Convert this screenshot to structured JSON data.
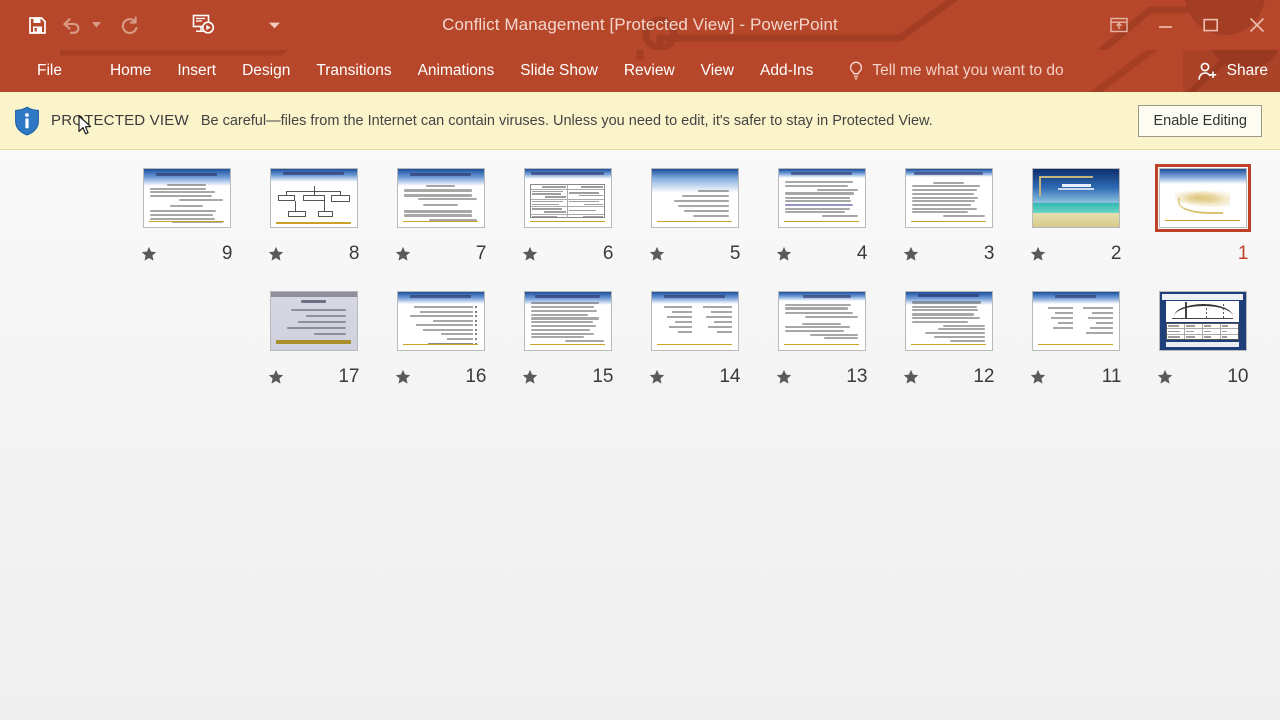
{
  "window": {
    "title": "Conflict Management [Protected View] - PowerPoint",
    "accent_color": "#b7472a"
  },
  "quick_access": {
    "items": [
      {
        "name": "save-icon",
        "label": "Save",
        "enabled": true
      },
      {
        "name": "undo-icon",
        "label": "Undo",
        "enabled": false
      },
      {
        "name": "undo-dropdown-icon",
        "label": "Undo options",
        "enabled": false
      },
      {
        "name": "redo-icon",
        "label": "Redo",
        "enabled": false
      },
      {
        "name": "start-from-beginning-icon",
        "label": "Start From Beginning",
        "enabled": true
      },
      {
        "name": "customize-quick-access-toolbar-icon",
        "label": "Customize Quick Access Toolbar",
        "enabled": true
      }
    ]
  },
  "window_controls": [
    {
      "name": "ribbon-display-options-icon",
      "label": "Ribbon Display Options"
    },
    {
      "name": "minimize-icon",
      "label": "Minimize"
    },
    {
      "name": "restore-icon",
      "label": "Restore Down"
    },
    {
      "name": "close-icon",
      "label": "Close"
    }
  ],
  "ribbon": {
    "tabs": [
      {
        "label": "File",
        "active": false
      },
      {
        "label": "Home",
        "active": false
      },
      {
        "label": "Insert",
        "active": false
      },
      {
        "label": "Design",
        "active": false
      },
      {
        "label": "Transitions",
        "active": false
      },
      {
        "label": "Animations",
        "active": false
      },
      {
        "label": "Slide Show",
        "active": false
      },
      {
        "label": "Review",
        "active": false
      },
      {
        "label": "View",
        "active": false
      },
      {
        "label": "Add-Ins",
        "active": false
      }
    ],
    "tell_me": "Tell me what you want to do",
    "share": "Share"
  },
  "protected_view": {
    "badge": "PROTECTED VIEW",
    "message": "Be careful—files from the Internet can contain viruses. Unless you need to edit, it's safer to stay in Protected View.",
    "button": "Enable Editing",
    "background_color": "#fbf4cb"
  },
  "slide_sorter": {
    "selected_slide": 1,
    "rows": [
      {
        "slides": [
          {
            "number": "9",
            "kind": "text",
            "selected": false,
            "lines": 11
          },
          {
            "number": "8",
            "kind": "orgchart",
            "selected": false
          },
          {
            "number": "7",
            "kind": "text",
            "selected": false,
            "lines": 9
          },
          {
            "number": "6",
            "kind": "table",
            "selected": false,
            "rows": 5,
            "cols": 2
          },
          {
            "number": "5",
            "kind": "text-sparse",
            "selected": false,
            "lines": 6
          },
          {
            "number": "4",
            "kind": "text",
            "selected": false,
            "lines": 10
          },
          {
            "number": "3",
            "kind": "text",
            "selected": false,
            "lines": 11
          },
          {
            "number": "2",
            "kind": "photo",
            "selected": false
          },
          {
            "number": "1",
            "kind": "title",
            "selected": true
          }
        ]
      },
      {
        "slides": [
          {
            "number": "17",
            "kind": "grey",
            "selected": false,
            "lines": 6
          },
          {
            "number": "16",
            "kind": "bullets",
            "selected": false,
            "lines": 10
          },
          {
            "number": "15",
            "kind": "text",
            "selected": false,
            "lines": 12
          },
          {
            "number": "14",
            "kind": "two-column",
            "selected": false,
            "lines": 7
          },
          {
            "number": "13",
            "kind": "bullets",
            "selected": false,
            "lines": 9
          },
          {
            "number": "12",
            "kind": "text",
            "selected": false,
            "lines": 12
          },
          {
            "number": "11",
            "kind": "two-column",
            "selected": false,
            "lines": 6
          },
          {
            "number": "10",
            "kind": "chart",
            "selected": false
          }
        ]
      }
    ],
    "badge_icon": "star-icon"
  }
}
